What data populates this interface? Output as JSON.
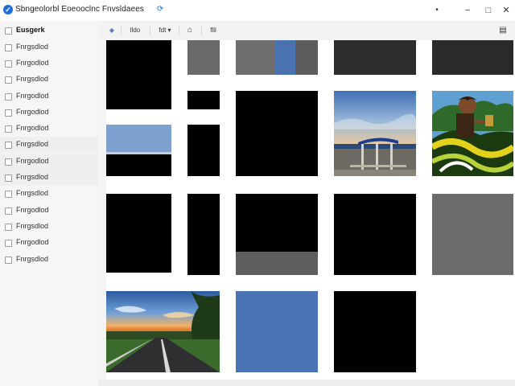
{
  "window": {
    "title": "Sbngeolorbl Eoeooclnc Fnvsldaees",
    "more_glyph": "•",
    "min_glyph": "−",
    "max_glyph": "□",
    "close_glyph": "✕",
    "accent": "#1e6fd9"
  },
  "sidebar": {
    "items": [
      {
        "label": "Eusgerk",
        "icon": "checkbox-icon",
        "header": true
      },
      {
        "label": "Fnrgsdlod"
      },
      {
        "label": "Fnrgodlod"
      },
      {
        "label": "Fnrgsdlod"
      },
      {
        "label": "Fnrgodlod"
      },
      {
        "label": "Fnrgodlod"
      },
      {
        "label": "Fnrgodlod"
      },
      {
        "label": "Fnrgsdlod"
      },
      {
        "label": "Fnrgodlod"
      },
      {
        "label": "Fnrgsdlod"
      },
      {
        "label": "Fnrgsdlod"
      },
      {
        "label": "Fnrgodlod"
      },
      {
        "label": "Fnrgsdlod"
      },
      {
        "label": "Fnrgodlod"
      },
      {
        "label": "Fnrgsdlod"
      }
    ]
  },
  "toolbar": {
    "nav_glyph": "◆",
    "btn1": "lldo",
    "btn2": "fdt ▾",
    "btn3_glyph": "⌂",
    "btn4": "flil",
    "view_glyph": "▤"
  },
  "gallery": {
    "tiles": [
      {
        "name": "thumb-black"
      },
      {
        "name": "thumb-gray"
      },
      {
        "name": "thumb-gray-blue"
      },
      {
        "name": "thumb-dark"
      },
      {
        "name": "thumb-dark"
      },
      {
        "name": "thumb-black"
      },
      {
        "name": "thumb-black"
      },
      {
        "name": "thumb-black"
      },
      {
        "name": "thumb-coast-shelter"
      },
      {
        "name": "thumb-illustration"
      },
      {
        "name": "thumb-sky-black"
      },
      {
        "name": "thumb-black"
      },
      {
        "name": "thumb-black-gray"
      },
      {
        "name": "thumb-black"
      },
      {
        "name": "thumb-gray"
      },
      {
        "name": "thumb-black"
      },
      {
        "name": "thumb-road-sunset"
      },
      {
        "name": "thumb-blue"
      },
      {
        "name": "thumb-black"
      }
    ]
  }
}
